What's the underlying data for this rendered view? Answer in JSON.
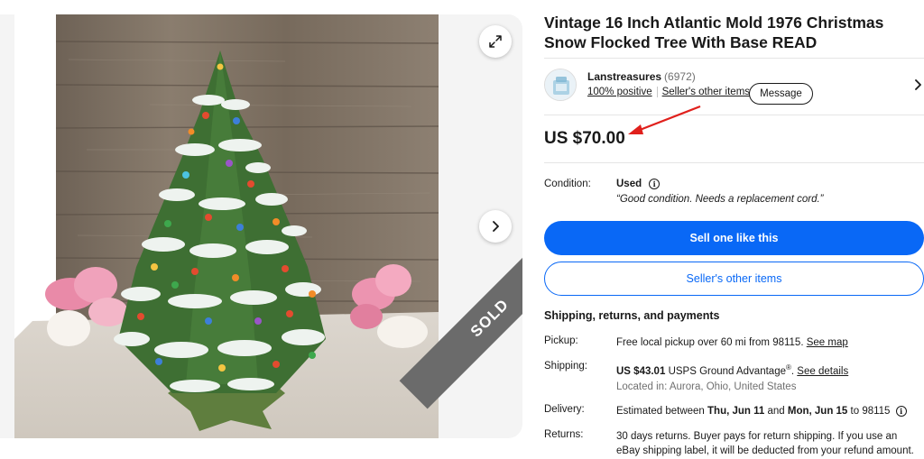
{
  "listing": {
    "title": "Vintage 16 Inch Atlantic Mold 1976 Christmas Snow Flocked Tree With Base READ",
    "sold_ribbon": "SOLD",
    "price": "US $70.00"
  },
  "seller": {
    "name": "Lanstreasures",
    "feedback_count": "(6972)",
    "positive": "100% positive",
    "other_items_link": "Seller's other items",
    "message_button": "Message"
  },
  "condition": {
    "label": "Condition:",
    "value": "Used",
    "note": "“Good condition. Needs a replacement cord.”"
  },
  "actions": {
    "primary": "Sell one like this",
    "secondary": "Seller's other items"
  },
  "shipping": {
    "heading": "Shipping, returns, and payments",
    "pickup_label": "Pickup:",
    "pickup_value": "Free local pickup over 60 mi from 98115.",
    "pickup_link": "See map",
    "shipping_label": "Shipping:",
    "shipping_cost": "US $43.01",
    "shipping_service": "USPS Ground Advantage",
    "shipping_reg": "®",
    "shipping_link": "See details",
    "located": "Located in: Aurora, Ohio, United States",
    "delivery_label": "Delivery:",
    "delivery_prefix": "Estimated between",
    "delivery_start": "Thu, Jun 11",
    "delivery_and": "and",
    "delivery_end": "Mon, Jun 15",
    "delivery_to": "to 98115",
    "returns_label": "Returns:",
    "returns_value": "30 days returns. Buyer pays for return shipping. If you use an eBay shipping label, it will be deducted from your refund amount."
  },
  "colors": {
    "accent": "#0968f6",
    "annotation_arrow": "#e0201c",
    "sold_ribbon": "#6b6b6b"
  },
  "icons": [
    "expand-icon",
    "chevron-right-icon",
    "info-icon",
    "arrow-annotation"
  ]
}
